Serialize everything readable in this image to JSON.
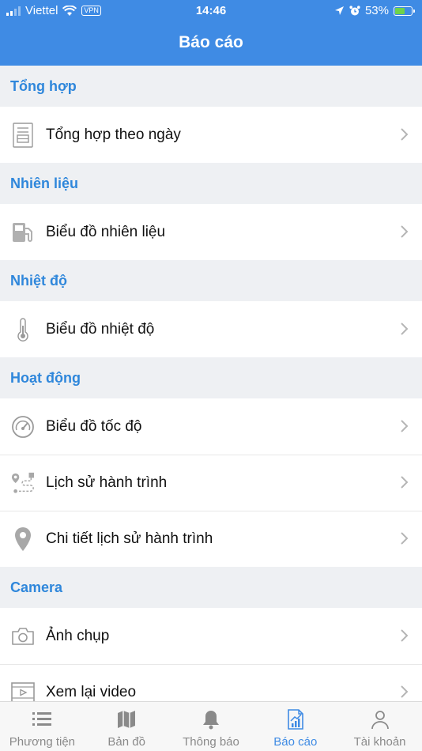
{
  "status_bar": {
    "carrier": "Viettel",
    "vpn": "VPN",
    "time": "14:46",
    "battery": "53%"
  },
  "header": {
    "title": "Báo cáo"
  },
  "sections": [
    {
      "title": "Tổng hợp",
      "items": [
        {
          "label": "Tổng hợp theo ngày",
          "icon": "document-icon"
        }
      ]
    },
    {
      "title": "Nhiên liệu",
      "items": [
        {
          "label": "Biểu đồ nhiên liệu",
          "icon": "fuel-pump-icon"
        }
      ]
    },
    {
      "title": "Nhiệt độ",
      "items": [
        {
          "label": "Biểu đồ nhiệt độ",
          "icon": "thermometer-icon"
        }
      ]
    },
    {
      "title": "Hoạt động",
      "items": [
        {
          "label": "Biểu đồ tốc độ",
          "icon": "speedometer-icon"
        },
        {
          "label": "Lịch sử hành trình",
          "icon": "route-icon"
        },
        {
          "label": "Chi tiết lịch sử hành trình",
          "icon": "location-pin-icon"
        }
      ]
    },
    {
      "title": "Camera",
      "items": [
        {
          "label": "Ảnh chụp",
          "icon": "camera-icon"
        },
        {
          "label": "Xem lại video",
          "icon": "video-icon"
        }
      ]
    }
  ],
  "tabs": [
    {
      "label": "Phương tiện",
      "icon": "list-icon",
      "active": false
    },
    {
      "label": "Bản đồ",
      "icon": "map-icon",
      "active": false
    },
    {
      "label": "Thông báo",
      "icon": "bell-icon",
      "active": false
    },
    {
      "label": "Báo cáo",
      "icon": "report-icon",
      "active": true
    },
    {
      "label": "Tài khoản",
      "icon": "user-icon",
      "active": false
    }
  ],
  "colors": {
    "primary": "#3f8be4",
    "section_text": "#2f87db",
    "background": "#eef0f3",
    "inactive_tab": "#8a8a8a"
  }
}
